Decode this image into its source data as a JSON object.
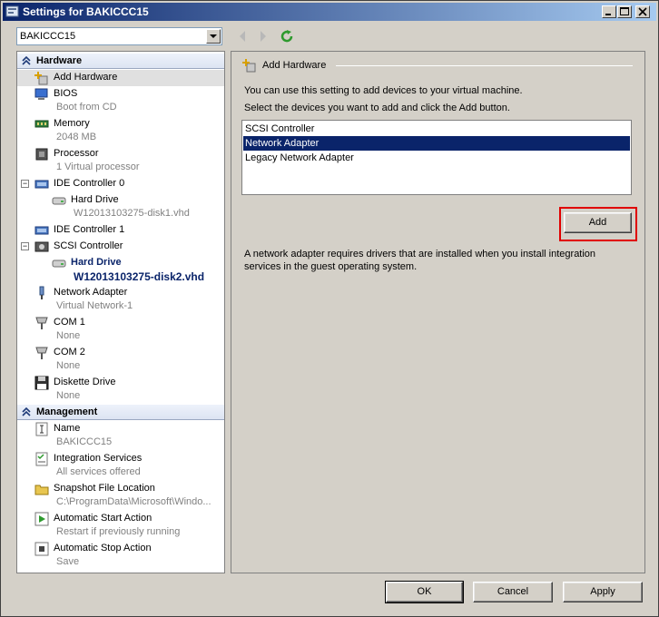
{
  "window": {
    "title": "Settings for BAKICCC15"
  },
  "vm_selector": {
    "value": "BAKICCC15"
  },
  "left_panel": {
    "hardware_header": "Hardware",
    "management_header": "Management",
    "hardware_items": [
      {
        "name": "Add Hardware",
        "sub": ""
      },
      {
        "name": "BIOS",
        "sub": "Boot from CD"
      },
      {
        "name": "Memory",
        "sub": "2048 MB"
      },
      {
        "name": "Processor",
        "sub": "1 Virtual processor"
      },
      {
        "name": "IDE Controller 0",
        "sub": ""
      },
      {
        "name": "Hard Drive",
        "sub": "W12013103275-disk1.vhd"
      },
      {
        "name": "IDE Controller 1",
        "sub": ""
      },
      {
        "name": "SCSI Controller",
        "sub": ""
      },
      {
        "name": "Hard Drive",
        "sub": "W12013103275-disk2.vhd"
      },
      {
        "name": "Network Adapter",
        "sub": "Virtual Network-1"
      },
      {
        "name": "COM 1",
        "sub": "None"
      },
      {
        "name": "COM 2",
        "sub": "None"
      },
      {
        "name": "Diskette Drive",
        "sub": "None"
      }
    ],
    "management_items": [
      {
        "name": "Name",
        "sub": "BAKICCC15"
      },
      {
        "name": "Integration Services",
        "sub": "All services offered"
      },
      {
        "name": "Snapshot File Location",
        "sub": "C:\\ProgramData\\Microsoft\\Windo..."
      },
      {
        "name": "Automatic Start Action",
        "sub": "Restart if previously running"
      },
      {
        "name": "Automatic Stop Action",
        "sub": "Save"
      }
    ]
  },
  "right_panel": {
    "heading": "Add Hardware",
    "intro": "You can use this setting to add devices to your virtual machine.",
    "instruction": "Select the devices you want to add and click the Add button.",
    "devices": [
      "SCSI Controller",
      "Network Adapter",
      "Legacy Network Adapter"
    ],
    "selected_device": "Network Adapter",
    "add_button": "Add",
    "note": "A network adapter requires drivers that are installed when you install integration services in the guest operating system."
  },
  "footer": {
    "ok": "OK",
    "cancel": "Cancel",
    "apply": "Apply"
  },
  "colors": {
    "selection": "#0a246a",
    "focus_outline": "#e00000",
    "title_gradient_start": "#0a246a"
  }
}
